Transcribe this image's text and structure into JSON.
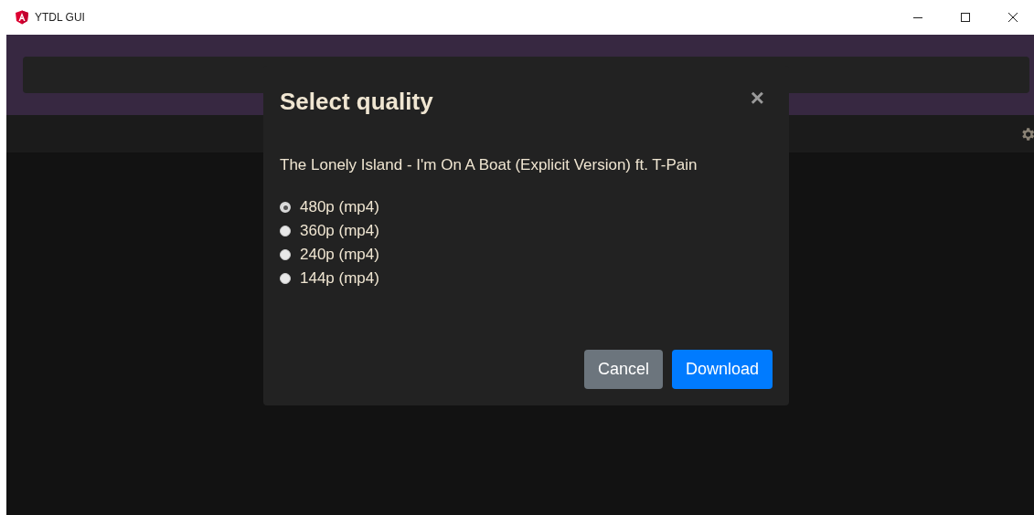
{
  "window": {
    "title": "YTDL GUI"
  },
  "dialog": {
    "title": "Select quality",
    "close": "×",
    "video_title": "The Lonely Island - I'm On A Boat (Explicit Version) ft. T-Pain",
    "options": [
      {
        "label": "480p (mp4)",
        "selected": true
      },
      {
        "label": "360p (mp4)",
        "selected": false
      },
      {
        "label": "240p (mp4)",
        "selected": false
      },
      {
        "label": "144p (mp4)",
        "selected": false
      }
    ],
    "buttons": [
      {
        "label": "Cancel",
        "kind": "secondary"
      },
      {
        "label": "Download",
        "kind": "primary"
      }
    ]
  }
}
